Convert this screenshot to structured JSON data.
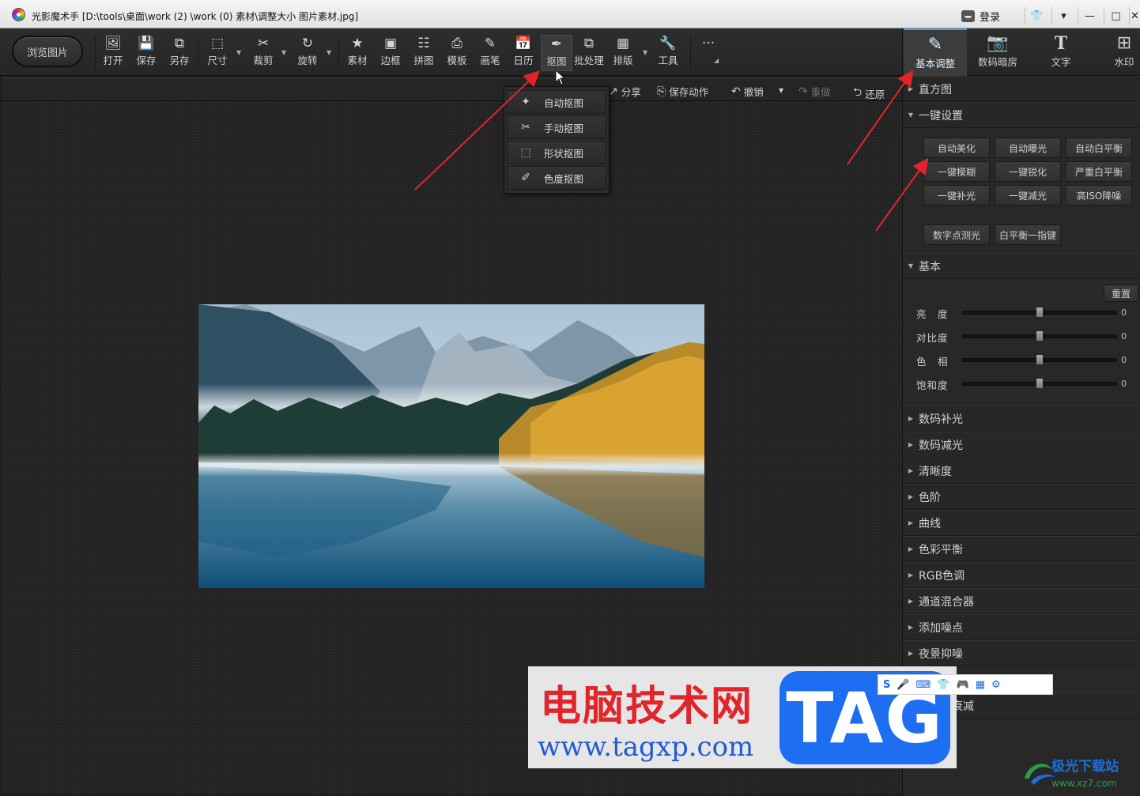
{
  "window": {
    "title": "光影魔术手 [D:\\tools\\桌面\\work (2) \\work (0) 素材\\调整大小 图片素材.jpg]",
    "login_label": "登录"
  },
  "toolbar": {
    "browse_label": "浏览图片",
    "tools": [
      {
        "label": "打开",
        "icon": "open-icon"
      },
      {
        "label": "保存",
        "icon": "save-icon"
      },
      {
        "label": "另存",
        "icon": "save-as-icon"
      },
      {
        "label": "尺寸",
        "icon": "resize-icon"
      },
      {
        "label": "裁剪",
        "icon": "crop-icon"
      },
      {
        "label": "旋转",
        "icon": "rotate-icon"
      },
      {
        "label": "素材",
        "icon": "material-icon"
      },
      {
        "label": "边框",
        "icon": "border-icon"
      },
      {
        "label": "拼图",
        "icon": "collage-icon"
      },
      {
        "label": "模板",
        "icon": "template-icon"
      },
      {
        "label": "画笔",
        "icon": "brush-icon"
      },
      {
        "label": "日历",
        "icon": "calendar-icon"
      },
      {
        "label": "抠图",
        "icon": "cutout-icon"
      },
      {
        "label": "批处理",
        "icon": "batch-icon"
      },
      {
        "label": "排版",
        "icon": "layout-icon"
      },
      {
        "label": "工具",
        "icon": "wrench-icon"
      }
    ],
    "more_label": "···"
  },
  "actionbar": {
    "share": "分享",
    "save_action": "保存动作",
    "undo": "撤销",
    "redo": "重做",
    "restore": "还原"
  },
  "cutout_menu": {
    "items": [
      {
        "label": "自动抠图",
        "icon": "auto-cutout-icon"
      },
      {
        "label": "手动抠图",
        "icon": "manual-cutout-icon"
      },
      {
        "label": "形状抠图",
        "icon": "shape-cutout-icon"
      },
      {
        "label": "色度抠图",
        "icon": "chroma-cutout-icon"
      }
    ]
  },
  "right_panel": {
    "tabs": [
      {
        "label": "基本调整",
        "icon": "basic-adjust-icon"
      },
      {
        "label": "数码暗房",
        "icon": "darkroom-icon"
      },
      {
        "label": "文字",
        "icon": "text-icon"
      },
      {
        "label": "水印",
        "icon": "watermark-icon"
      }
    ],
    "histogram": "直方图",
    "one_click": {
      "title": "一键设置",
      "buttons": [
        "自动美化",
        "自动曝光",
        "自动白平衡",
        "一键模糊",
        "一键锐化",
        "严重白平衡",
        "一键补光",
        "一键减光",
        "高ISO降噪"
      ],
      "extra_buttons": [
        "数字点测光",
        "白平衡一指键"
      ]
    },
    "basic": {
      "title": "基本",
      "reset": "重置",
      "sliders": [
        {
          "label": "亮　度",
          "value": "0",
          "level": 0.5
        },
        {
          "label": "对比度",
          "value": "0",
          "level": 0.5
        },
        {
          "label": "色　相",
          "value": "0",
          "level": 0.5
        },
        {
          "label": "饱和度",
          "value": "0",
          "level": 0.5
        }
      ]
    },
    "sections": [
      "数码补光",
      "数码减光",
      "清晰度",
      "色阶",
      "曲线",
      "色彩平衡",
      "RGB色调",
      "通道混合器",
      "添加噪点",
      "夜景抑噪",
      "红饱和衰减"
    ]
  },
  "watermark": {
    "cn_text": "电脑技术网",
    "url": "www.tagxp.com",
    "tag": "TAG",
    "site_logo_text": "极光下载站",
    "site_url": "www.xz7.com"
  },
  "colors": {
    "accent_blue": "#4a9bd8",
    "arrow_red": "#e0262b"
  }
}
